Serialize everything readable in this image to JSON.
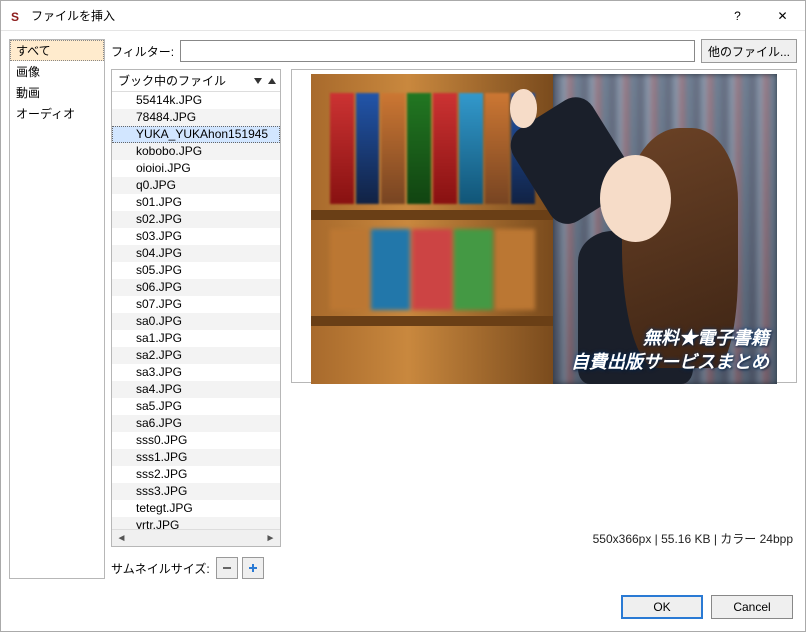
{
  "window": {
    "title": "ファイルを挿入",
    "help": "?",
    "close": "✕"
  },
  "sidebar": {
    "items": [
      {
        "label": "すべて",
        "selected": true
      },
      {
        "label": "画像",
        "selected": false
      },
      {
        "label": "動画",
        "selected": false
      },
      {
        "label": "オーディオ",
        "selected": false
      }
    ]
  },
  "filter": {
    "label": "フィルター:",
    "value": "",
    "other_files": "他のファイル..."
  },
  "filepanel": {
    "header": "ブック中のファイル",
    "files": [
      "55414k.JPG",
      "78484.JPG",
      "YUKA_YUKAhon151945",
      "kobobo.JPG",
      "oioioi.JPG",
      "q0.JPG",
      "s01.JPG",
      "s02.JPG",
      "s03.JPG",
      "s04.JPG",
      "s05.JPG",
      "s06.JPG",
      "s07.JPG",
      "sa0.JPG",
      "sa1.JPG",
      "sa2.JPG",
      "sa3.JPG",
      "sa4.JPG",
      "sa5.JPG",
      "sa6.JPG",
      "sss0.JPG",
      "sss1.JPG",
      "sss2.JPG",
      "sss3.JPG",
      "tetegt.JPG",
      "yrtr.JPG"
    ],
    "selected_index": 2
  },
  "preview": {
    "overlay_line1": "無料★電子書籍",
    "overlay_line2": "自費出版サービスまとめ"
  },
  "thumb": {
    "label": "サムネイルサイズ:"
  },
  "status": {
    "text": "550x366px | 55.16 KB | カラー 24bpp"
  },
  "footer": {
    "ok": "OK",
    "cancel": "Cancel"
  }
}
